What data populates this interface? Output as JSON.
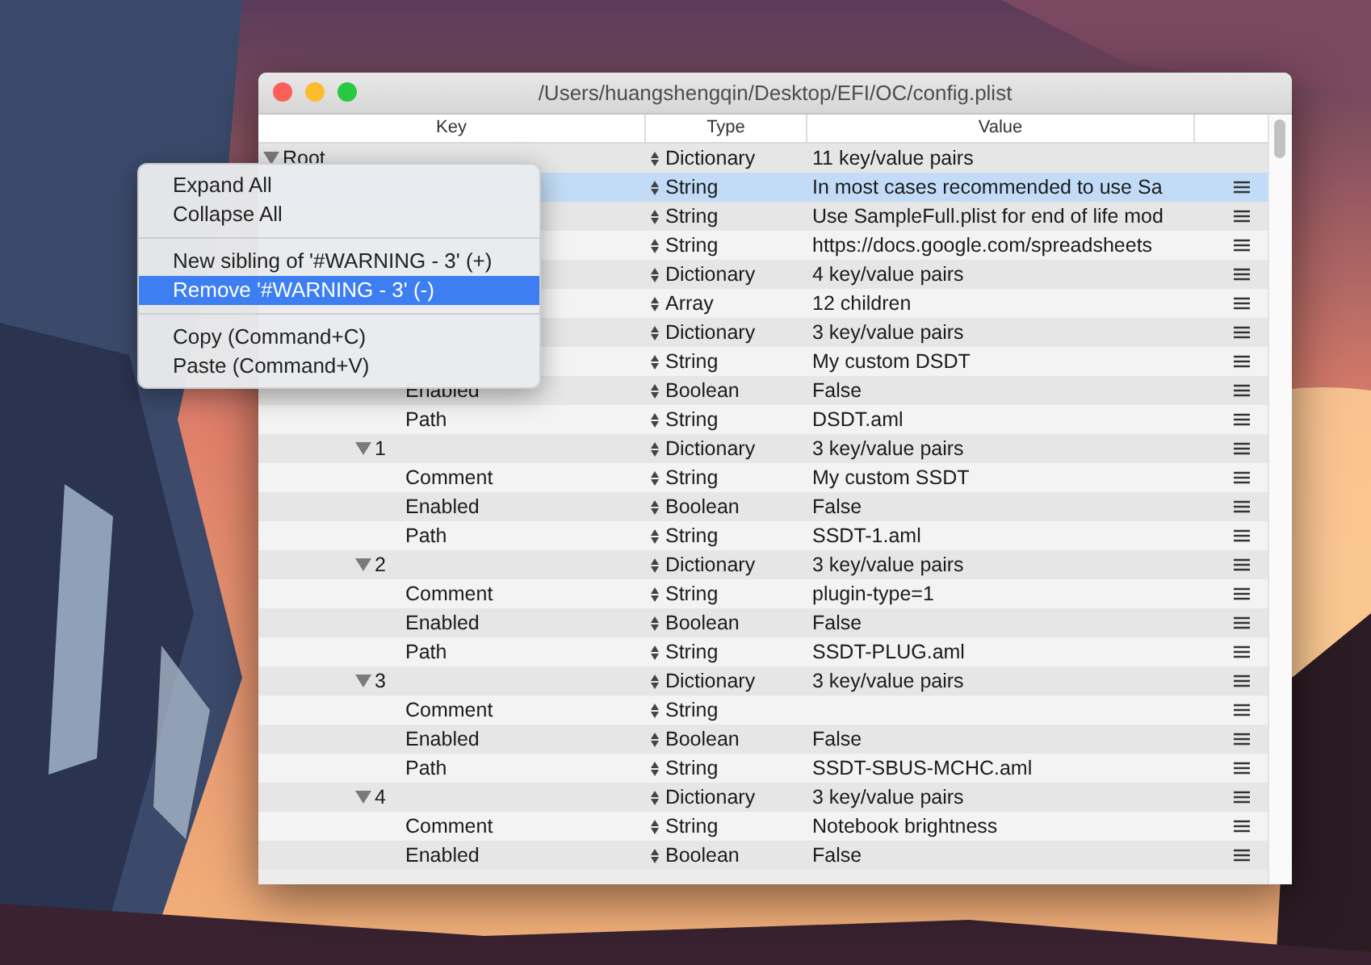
{
  "window": {
    "title": "/Users/huangshengqin/Desktop/EFI/OC/config.plist"
  },
  "table": {
    "columns": [
      "Key",
      "Type",
      "Value"
    ],
    "rows": [
      {
        "key": "Root",
        "type": "Dictionary",
        "value": "11 key/value pairs",
        "expanded": true,
        "selected": false,
        "children": [
          {
            "type": "String",
            "value": "In most cases recommended to use Sa",
            "selected": true
          },
          {
            "type": "String",
            "value": "Use SampleFull.plist for end of life mod",
            "selected": false
          },
          {
            "type": "String",
            "value": "https://docs.google.com/spreadsheets",
            "selected": false
          },
          {
            "type": "Dictionary",
            "value": "4 key/value pairs",
            "selected": false,
            "children": [
              {
                "type": "Array",
                "value": "12 children",
                "selected": false,
                "children": [
                  {
                    "type": "Dictionary",
                    "value": "3 key/value pairs",
                    "selected": false,
                    "children": [
                      {
                        "type": "String",
                        "value": "My custom DSDT",
                        "selected": false
                      },
                      {
                        "key": "Enabled",
                        "type": "Boolean",
                        "value": "False",
                        "selected": false
                      },
                      {
                        "key": "Path",
                        "type": "String",
                        "value": "DSDT.aml",
                        "selected": false
                      }
                    ]
                  },
                  {
                    "key": "1",
                    "type": "Dictionary",
                    "value": "3 key/value pairs",
                    "expanded": true,
                    "selected": false,
                    "children": [
                      {
                        "key": "Comment",
                        "type": "String",
                        "value": "My custom SSDT",
                        "selected": false
                      },
                      {
                        "key": "Enabled",
                        "type": "Boolean",
                        "value": "False",
                        "selected": false
                      },
                      {
                        "key": "Path",
                        "type": "String",
                        "value": "SSDT-1.aml",
                        "selected": false
                      }
                    ]
                  },
                  {
                    "key": "2",
                    "type": "Dictionary",
                    "value": "3 key/value pairs",
                    "expanded": true,
                    "selected": false,
                    "children": [
                      {
                        "key": "Comment",
                        "type": "String",
                        "value": "plugin-type=1",
                        "selected": false
                      },
                      {
                        "key": "Enabled",
                        "type": "Boolean",
                        "value": "False",
                        "selected": false
                      },
                      {
                        "key": "Path",
                        "type": "String",
                        "value": "SSDT-PLUG.aml",
                        "selected": false
                      }
                    ]
                  },
                  {
                    "key": "3",
                    "type": "Dictionary",
                    "value": "3 key/value pairs",
                    "expanded": true,
                    "selected": false,
                    "children": [
                      {
                        "key": "Comment",
                        "type": "String",
                        "selected": false
                      },
                      {
                        "key": "Enabled",
                        "type": "Boolean",
                        "value": "False",
                        "selected": false
                      },
                      {
                        "key": "Path",
                        "type": "String",
                        "value": "SSDT-SBUS-MCHC.aml",
                        "selected": false
                      }
                    ]
                  },
                  {
                    "key": "4",
                    "type": "Dictionary",
                    "value": "3 key/value pairs",
                    "expanded": true,
                    "selected": false,
                    "children": [
                      {
                        "key": "Comment",
                        "type": "String",
                        "value": "Notebook brightness",
                        "selected": false
                      },
                      {
                        "key": "Enabled",
                        "type": "Boolean",
                        "value": "False",
                        "selected": false
                      }
                    ]
                  }
                ]
              }
            ]
          }
        ]
      }
    ]
  },
  "context_menu": {
    "groups": [
      [
        {
          "label": "Expand All",
          "selected": false
        },
        {
          "label": "Collapse All",
          "selected": false
        }
      ],
      [
        {
          "label": "New sibling of '#WARNING - 3' (+)",
          "selected": false
        },
        {
          "label": "Remove '#WARNING - 3' (-)",
          "selected": true
        }
      ],
      [
        {
          "label": "Copy (Command+C)",
          "selected": false
        },
        {
          "label": "Paste (Command+V)",
          "selected": false
        }
      ]
    ]
  }
}
